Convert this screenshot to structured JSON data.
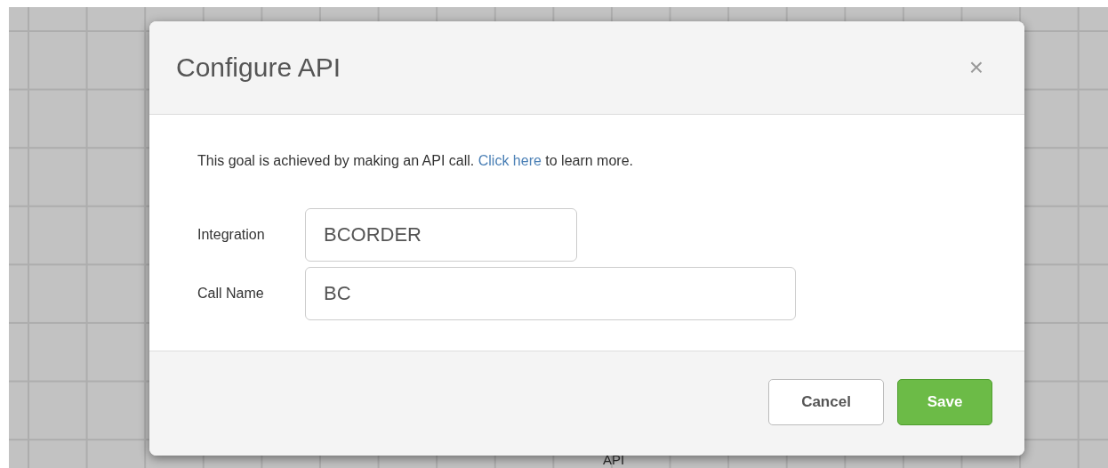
{
  "canvas": {
    "node_label": "API"
  },
  "dialog": {
    "title": "Configure API",
    "close": "×",
    "intro": {
      "before": "This goal is achieved by making an API call. ",
      "link": "Click here",
      "after": " to learn more."
    },
    "fields": [
      {
        "label": "Integration",
        "value": "BCORDER"
      },
      {
        "label": "Call Name",
        "value": "BC"
      }
    ],
    "buttons": [
      {
        "label": "Cancel",
        "kind": "secondary"
      },
      {
        "label": "Save",
        "kind": "primary"
      }
    ]
  }
}
